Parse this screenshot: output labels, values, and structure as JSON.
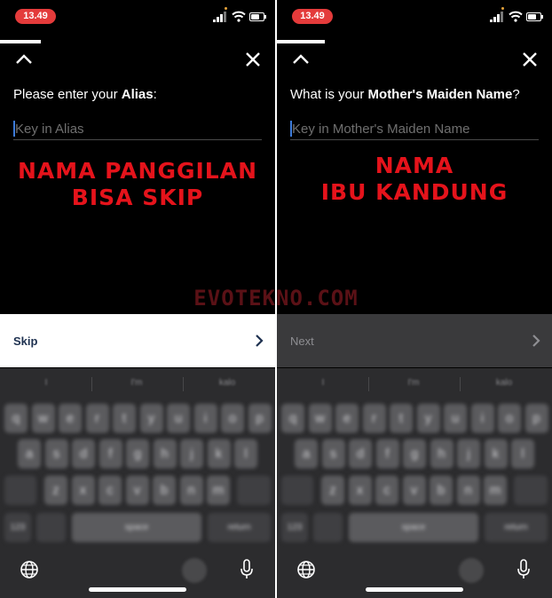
{
  "screens": [
    {
      "status_time": "13.49",
      "prompt_prefix": "Please enter your ",
      "prompt_field": "Alias",
      "prompt_suffix": ":",
      "input_value": "",
      "input_placeholder": "Key in Alias",
      "annotation_lines": [
        "NAMA PANGGILAN",
        "BISA SKIP"
      ],
      "action_label": "Skip",
      "keyboard": {
        "suggestions": [
          "I",
          "I'm",
          "kalo"
        ],
        "row1": [
          "q",
          "w",
          "e",
          "r",
          "t",
          "y",
          "u",
          "i",
          "o",
          "p"
        ],
        "row2": [
          "a",
          "s",
          "d",
          "f",
          "g",
          "h",
          "j",
          "k",
          "l"
        ],
        "row3": [
          "z",
          "x",
          "c",
          "v",
          "b",
          "n",
          "m"
        ],
        "numbers_key": "123",
        "space_key": "space",
        "return_key": "return"
      }
    },
    {
      "status_time": "13.49",
      "prompt_prefix": "What is your ",
      "prompt_field": "Mother's Maiden Name",
      "prompt_suffix": "?",
      "input_value": "",
      "input_placeholder": "Key in Mother's Maiden Name",
      "annotation_lines": [
        "NAMA",
        "IBU KANDUNG"
      ],
      "action_label": "Next",
      "keyboard": {
        "suggestions": [
          "I",
          "I'm",
          "kalo"
        ],
        "row1": [
          "q",
          "w",
          "e",
          "r",
          "t",
          "y",
          "u",
          "i",
          "o",
          "p"
        ],
        "row2": [
          "a",
          "s",
          "d",
          "f",
          "g",
          "h",
          "j",
          "k",
          "l"
        ],
        "row3": [
          "z",
          "x",
          "c",
          "v",
          "b",
          "n",
          "m"
        ],
        "numbers_key": "123",
        "space_key": "space",
        "return_key": "return"
      }
    }
  ],
  "watermark": "EVOTEKNO.COM",
  "icons": [
    "chevron-up-icon",
    "close-icon",
    "chevron-right-icon",
    "globe-icon",
    "mic-icon",
    "signal-icon",
    "wifi-icon",
    "battery-icon"
  ],
  "colors": {
    "time_pill": "#e43b3b",
    "annotation": "#e5131b",
    "skip_bar": "#ffffff",
    "next_bar": "#3a3a3c",
    "caret": "#3d7bd9"
  }
}
